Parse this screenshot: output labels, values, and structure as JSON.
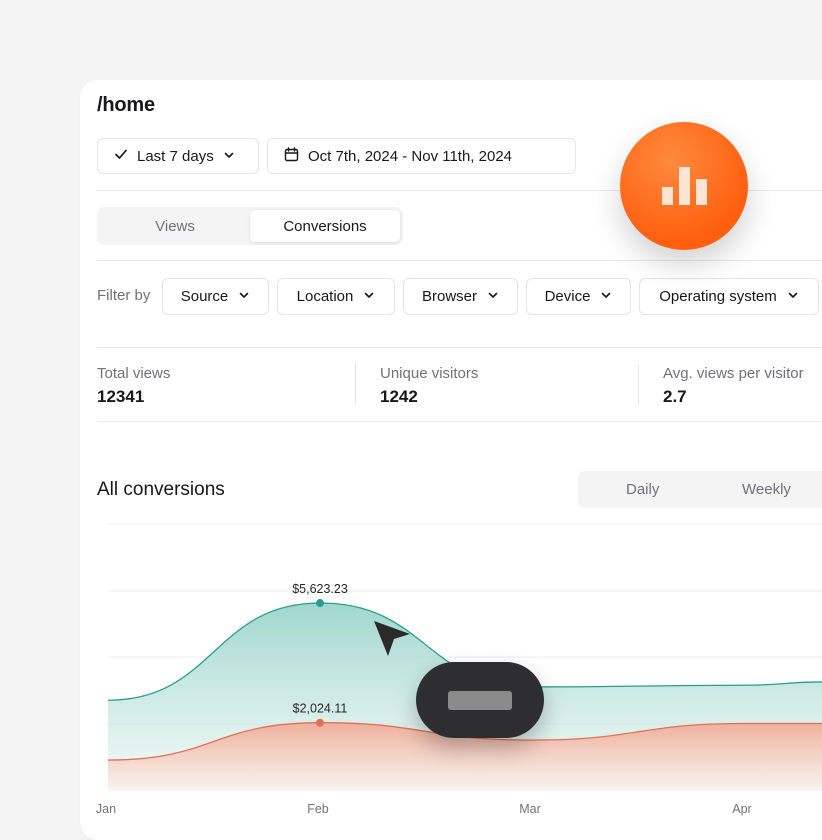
{
  "page": {
    "path": "/home"
  },
  "controls": {
    "range_label": "Last 7 days",
    "date_range": "Oct 7th, 2024 - Nov 11th, 2024"
  },
  "tabs": [
    {
      "label": "Views",
      "active": false
    },
    {
      "label": "Conversions",
      "active": true
    }
  ],
  "filters": {
    "label": "Filter by",
    "items": [
      "Source",
      "Location",
      "Browser",
      "Device",
      "Operating system"
    ]
  },
  "stats": [
    {
      "label": "Total views",
      "value": "12341"
    },
    {
      "label": "Unique visitors",
      "value": "1242"
    },
    {
      "label": "Avg. views per visitor",
      "value": "2.7"
    }
  ],
  "chart_section": {
    "title": "All conversions",
    "period_options": [
      "Daily",
      "Weekly"
    ]
  },
  "colors": {
    "accent_orange": "#ff5f0f",
    "series_green": "#2a9d8f",
    "series_red": "#e76f51"
  },
  "icons": [
    "check-icon",
    "chevron-down-icon",
    "calendar-icon",
    "bar-chart-icon",
    "cursor-arrow-icon"
  ],
  "chart_data": {
    "type": "area",
    "categories": [
      "Jan",
      "Feb",
      "Mar",
      "Apr"
    ],
    "series": [
      {
        "color": "#2a9d8f",
        "values": [
          2700,
          5623.23,
          3100,
          3150
        ],
        "point_label": "$5,623.23"
      },
      {
        "color": "#e76f51",
        "values": [
          900,
          2024.11,
          1500,
          2000
        ],
        "point_label": "$2,024.11"
      }
    ],
    "annotations": [
      "$5,623.23",
      "$2,024.11"
    ],
    "grid": true,
    "ylim": [
      0,
      8000
    ]
  }
}
